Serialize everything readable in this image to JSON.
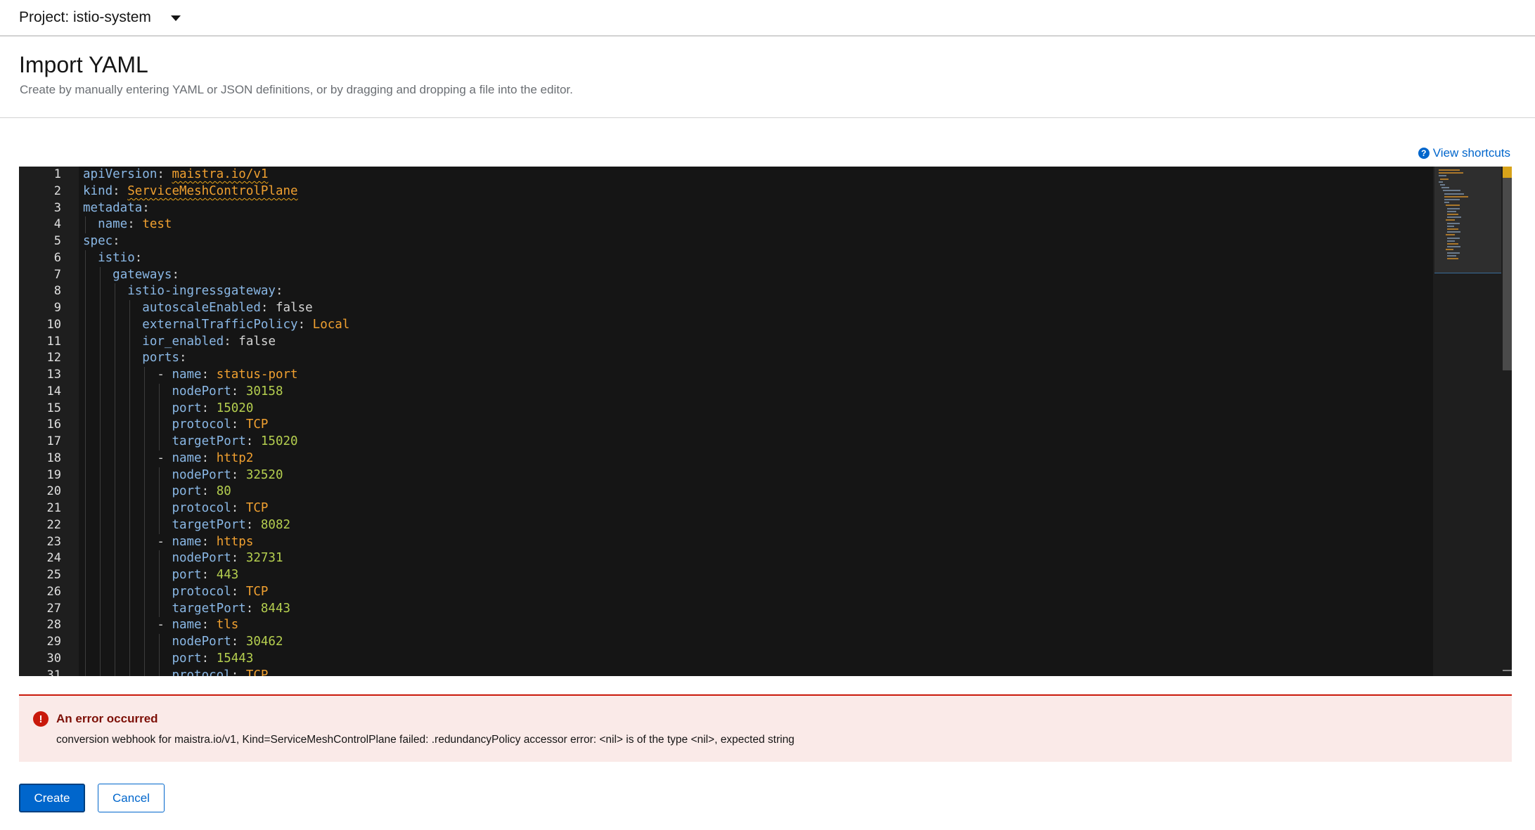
{
  "project": {
    "label": "Project: istio-system"
  },
  "header": {
    "title": "Import YAML",
    "subtitle": "Create by manually entering YAML or JSON definitions, or by dragging and dropping a file into the editor."
  },
  "shortcuts": {
    "label": "View shortcuts"
  },
  "editor": {
    "line_numbers": [
      "1",
      "2",
      "3",
      "4",
      "5",
      "6",
      "7",
      "8",
      "9",
      "10",
      "11",
      "12",
      "13",
      "14",
      "15",
      "16",
      "17",
      "18",
      "19",
      "20",
      "21",
      "22",
      "23",
      "24",
      "25",
      "26",
      "27",
      "28",
      "29",
      "30",
      "31"
    ],
    "lines": [
      {
        "indent": 0,
        "dash": false,
        "key": "apiVersion",
        "value": "maistra.io/v1",
        "vtype": "s",
        "squiggle": true
      },
      {
        "indent": 0,
        "dash": false,
        "key": "kind",
        "value": "ServiceMeshControlPlane",
        "vtype": "s",
        "squiggle": true
      },
      {
        "indent": 0,
        "dash": false,
        "key": "metadata",
        "value": "",
        "vtype": "s"
      },
      {
        "indent": 1,
        "dash": false,
        "key": "name",
        "value": "test",
        "vtype": "s"
      },
      {
        "indent": 0,
        "dash": false,
        "key": "spec",
        "value": "",
        "vtype": "s"
      },
      {
        "indent": 1,
        "dash": false,
        "key": "istio",
        "value": "",
        "vtype": "s"
      },
      {
        "indent": 2,
        "dash": false,
        "key": "gateways",
        "value": "",
        "vtype": "s"
      },
      {
        "indent": 3,
        "dash": false,
        "key": "istio-ingressgateway",
        "value": "",
        "vtype": "s"
      },
      {
        "indent": 4,
        "dash": false,
        "key": "autoscaleEnabled",
        "value": "false",
        "vtype": "b"
      },
      {
        "indent": 4,
        "dash": false,
        "key": "externalTrafficPolicy",
        "value": "Local",
        "vtype": "s"
      },
      {
        "indent": 4,
        "dash": false,
        "key": "ior_enabled",
        "value": "false",
        "vtype": "b"
      },
      {
        "indent": 4,
        "dash": false,
        "key": "ports",
        "value": "",
        "vtype": "s"
      },
      {
        "indent": 5,
        "dash": true,
        "key": "name",
        "value": "status-port",
        "vtype": "s"
      },
      {
        "indent": 6,
        "dash": false,
        "key": "nodePort",
        "value": "30158",
        "vtype": "n"
      },
      {
        "indent": 6,
        "dash": false,
        "key": "port",
        "value": "15020",
        "vtype": "n"
      },
      {
        "indent": 6,
        "dash": false,
        "key": "protocol",
        "value": "TCP",
        "vtype": "s"
      },
      {
        "indent": 6,
        "dash": false,
        "key": "targetPort",
        "value": "15020",
        "vtype": "n"
      },
      {
        "indent": 5,
        "dash": true,
        "key": "name",
        "value": "http2",
        "vtype": "s"
      },
      {
        "indent": 6,
        "dash": false,
        "key": "nodePort",
        "value": "32520",
        "vtype": "n"
      },
      {
        "indent": 6,
        "dash": false,
        "key": "port",
        "value": "80",
        "vtype": "n"
      },
      {
        "indent": 6,
        "dash": false,
        "key": "protocol",
        "value": "TCP",
        "vtype": "s"
      },
      {
        "indent": 6,
        "dash": false,
        "key": "targetPort",
        "value": "8082",
        "vtype": "n"
      },
      {
        "indent": 5,
        "dash": true,
        "key": "name",
        "value": "https",
        "vtype": "s"
      },
      {
        "indent": 6,
        "dash": false,
        "key": "nodePort",
        "value": "32731",
        "vtype": "n"
      },
      {
        "indent": 6,
        "dash": false,
        "key": "port",
        "value": "443",
        "vtype": "n"
      },
      {
        "indent": 6,
        "dash": false,
        "key": "protocol",
        "value": "TCP",
        "vtype": "s"
      },
      {
        "indent": 6,
        "dash": false,
        "key": "targetPort",
        "value": "8443",
        "vtype": "n"
      },
      {
        "indent": 5,
        "dash": true,
        "key": "name",
        "value": "tls",
        "vtype": "s"
      },
      {
        "indent": 6,
        "dash": false,
        "key": "nodePort",
        "value": "30462",
        "vtype": "n"
      },
      {
        "indent": 6,
        "dash": false,
        "key": "port",
        "value": "15443",
        "vtype": "n"
      },
      {
        "indent": 6,
        "dash": false,
        "key": "protocol",
        "value": "TCP",
        "vtype": "s"
      }
    ]
  },
  "alert": {
    "title": "An error occurred",
    "message": "conversion webhook for maistra.io/v1, Kind=ServiceMeshControlPlane failed: .redundancyPolicy accessor error: <nil> is of the type <nil>, expected string"
  },
  "buttons": {
    "create": "Create",
    "cancel": "Cancel"
  },
  "colors": {
    "primary": "#0066cc",
    "danger": "#c9190b",
    "editor_bg": "#151515"
  }
}
